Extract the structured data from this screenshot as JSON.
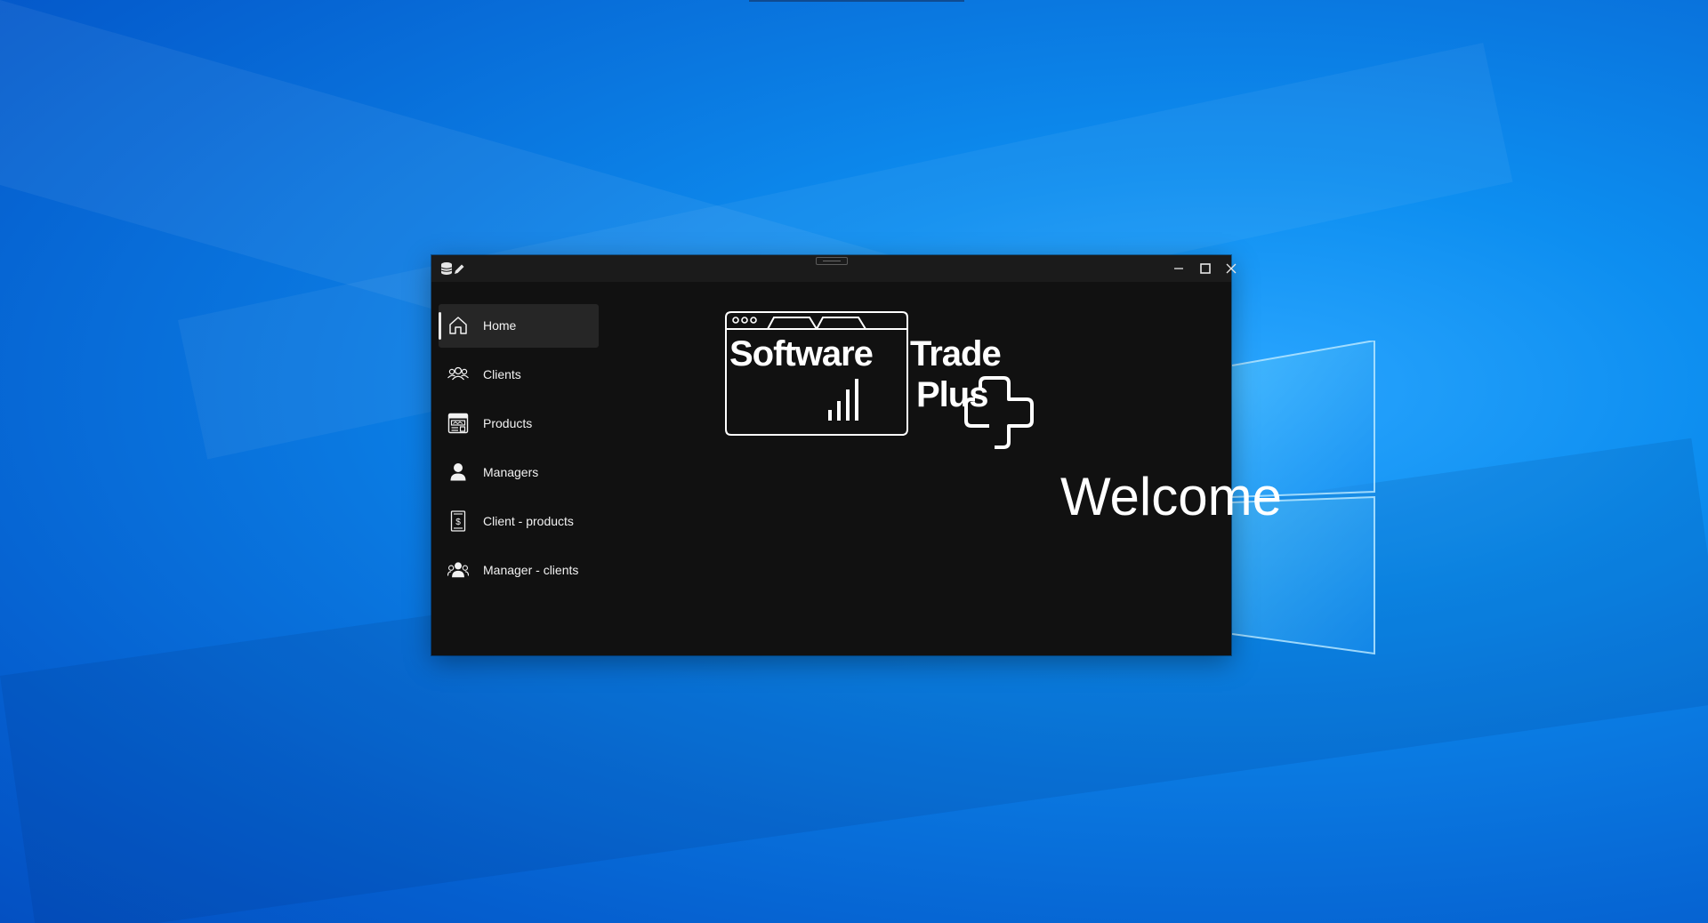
{
  "window": {
    "app_icon": "database-edit-icon",
    "controls": {
      "minimize_icon": "minimize-icon",
      "maximize_icon": "maximize-icon",
      "close_icon": "close-icon"
    }
  },
  "sidebar": {
    "items": [
      {
        "label": "Home",
        "icon": "home-icon",
        "active": true
      },
      {
        "label": "Clients",
        "icon": "clients-icon",
        "active": false
      },
      {
        "label": "Products",
        "icon": "products-icon",
        "active": false
      },
      {
        "label": "Managers",
        "icon": "manager-icon",
        "active": false
      },
      {
        "label": "Client - products",
        "icon": "receipt-icon",
        "active": false
      },
      {
        "label": "Manager - clients",
        "icon": "manager-clients-icon",
        "active": false
      }
    ]
  },
  "main": {
    "logo": {
      "word1": "Software",
      "word2": "Trade",
      "word3": "Plus"
    },
    "welcome_text": "Welcome"
  },
  "colors": {
    "window_bg": "#111111",
    "titlebar_bg": "#1b1b1b",
    "active_item_bg": "#262626",
    "text": "#ffffff",
    "desktop_blue": "#0a78e0"
  }
}
